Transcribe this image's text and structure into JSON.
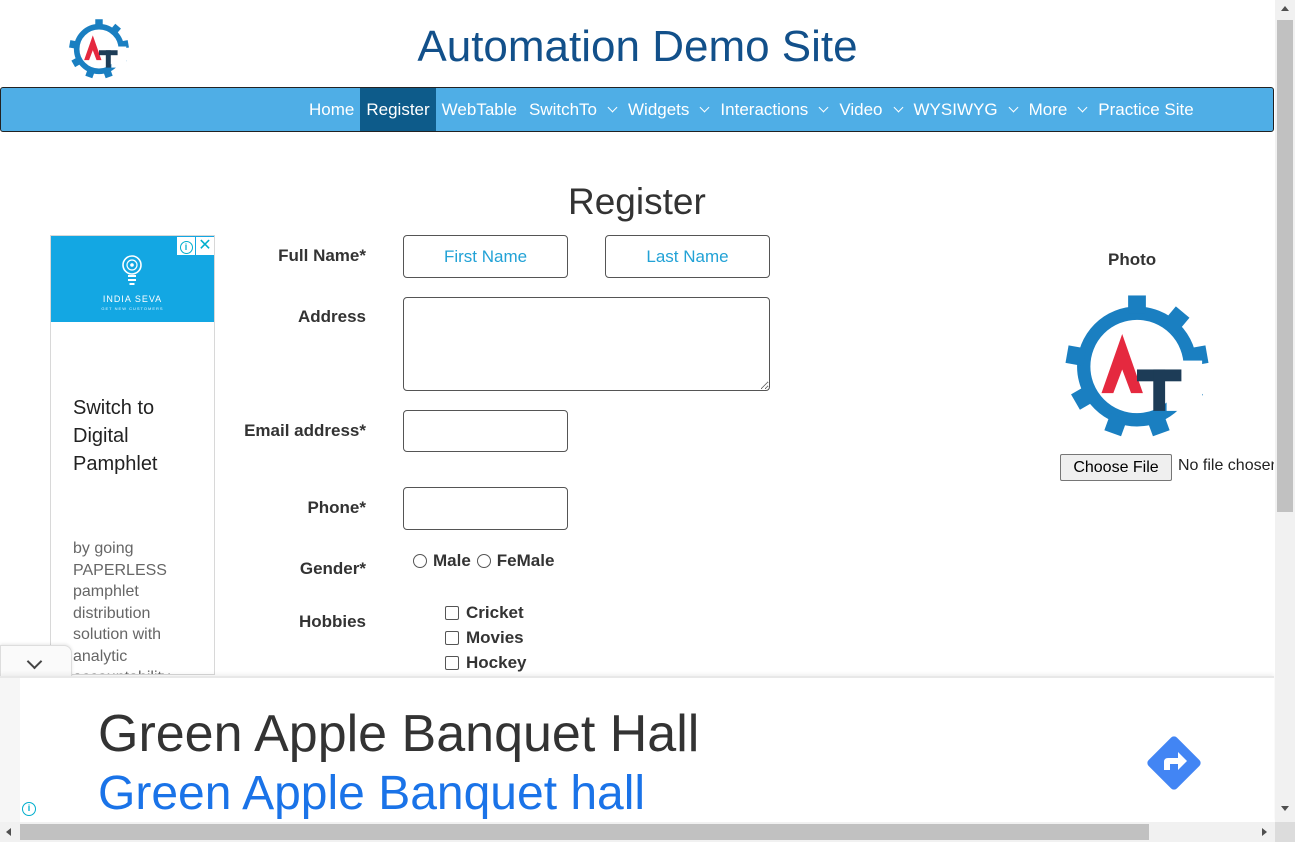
{
  "header": {
    "title": "Automation Demo Site",
    "logo_icon": "automation-testing-gear-logo",
    "logo_colors": {
      "gear": "#1a7fc1",
      "a": "#e5293f",
      "t": "#1d3c57"
    }
  },
  "nav": {
    "items": [
      {
        "label": "Home",
        "active": false,
        "dropdown": false
      },
      {
        "label": "Register",
        "active": true,
        "dropdown": false
      },
      {
        "label": "WebTable",
        "active": false,
        "dropdown": false
      },
      {
        "label": "SwitchTo",
        "active": false,
        "dropdown": true
      },
      {
        "label": "Widgets",
        "active": false,
        "dropdown": true
      },
      {
        "label": "Interactions",
        "active": false,
        "dropdown": true
      },
      {
        "label": "Video",
        "active": false,
        "dropdown": true
      },
      {
        "label": "WYSIWYG",
        "active": false,
        "dropdown": true
      },
      {
        "label": "More",
        "active": false,
        "dropdown": true
      },
      {
        "label": "Practice Site",
        "active": false,
        "dropdown": false
      }
    ],
    "bar_color": "#4faee6",
    "active_color": "#0d5b8a"
  },
  "page": {
    "heading": "Register"
  },
  "form": {
    "full_name_label": "Full Name*",
    "first_name_placeholder": "First Name",
    "last_name_placeholder": "Last Name",
    "address_label": "Address",
    "address_value": "",
    "email_label": "Email address*",
    "email_value": "",
    "phone_label": "Phone*",
    "phone_value": "",
    "gender_label": "Gender*",
    "gender_options": [
      "Male",
      "FeMale"
    ],
    "hobbies_label": "Hobbies",
    "hobbies": [
      "Cricket",
      "Movies",
      "Hockey"
    ]
  },
  "photo": {
    "label": "Photo",
    "choose_button": "Choose File",
    "no_file_text": "No file chosen"
  },
  "left_ad": {
    "brand": "INDIA SEVA",
    "brand_tagline": "GET NEW CUSTOMERS",
    "headline": "Switch to Digital Pamphlet",
    "body": "by going PAPERLESS pamphlet distribution solution with analytic accountability",
    "banner_color": "#13a7e3",
    "info_icon": "i",
    "close_icon": "✕"
  },
  "bottom_ad": {
    "title": "Green Apple Banquet Hall",
    "subtitle": "Green Apple Banquet hall",
    "info_icon": "i",
    "direction_icon": "directions-arrow-icon",
    "subtitle_color": "#1a73e8",
    "arrow_color": "#4285f4"
  }
}
